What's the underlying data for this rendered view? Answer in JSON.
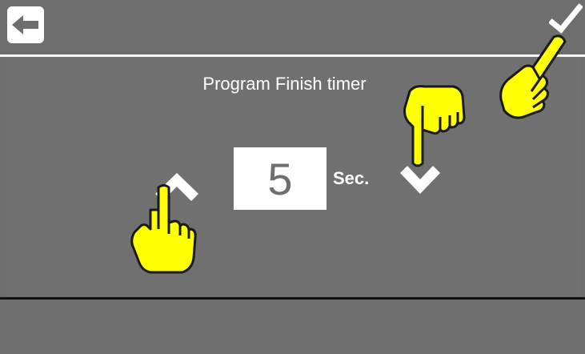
{
  "header": {
    "back_icon": "arrow-left-icon",
    "confirm_icon": "checkmark-icon"
  },
  "main": {
    "title": "Program Finish timer",
    "value": "5",
    "unit": "Sec.",
    "increase_icon": "chevron-up-icon",
    "decrease_icon": "chevron-down-icon"
  },
  "overlay": {
    "hand_icon": "pointing-hand-icon"
  },
  "colors": {
    "background": "#6e6e6e",
    "panel": "#707070",
    "highlight": "#ffff00",
    "text": "#ffffff"
  }
}
